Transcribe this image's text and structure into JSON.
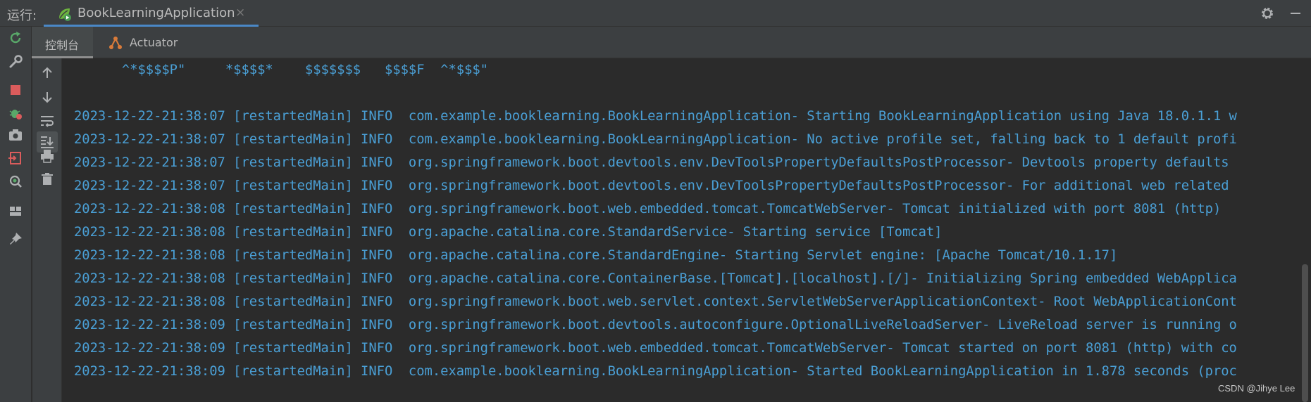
{
  "topbar": {
    "run_label": "运行:",
    "tab_title": "BookLearningApplication",
    "tab_close": "×"
  },
  "subtabs": {
    "console": "控制台",
    "actuator": "Actuator"
  },
  "console": {
    "lines": [
      "      ^*$$$$P\"     *$$$$*    $$$$$$$   $$$$F  ^*$$$\"",
      "",
      "2023-12-22-21:38:07 [restartedMain] INFO  com.example.booklearning.BookLearningApplication- Starting BookLearningApplication using Java 18.0.1.1 w",
      "2023-12-22-21:38:07 [restartedMain] INFO  com.example.booklearning.BookLearningApplication- No active profile set, falling back to 1 default profi",
      "2023-12-22-21:38:07 [restartedMain] INFO  org.springframework.boot.devtools.env.DevToolsPropertyDefaultsPostProcessor- Devtools property defaults",
      "2023-12-22-21:38:07 [restartedMain] INFO  org.springframework.boot.devtools.env.DevToolsPropertyDefaultsPostProcessor- For additional web related",
      "2023-12-22-21:38:08 [restartedMain] INFO  org.springframework.boot.web.embedded.tomcat.TomcatWebServer- Tomcat initialized with port 8081 (http)",
      "2023-12-22-21:38:08 [restartedMain] INFO  org.apache.catalina.core.StandardService- Starting service [Tomcat]",
      "2023-12-22-21:38:08 [restartedMain] INFO  org.apache.catalina.core.StandardEngine- Starting Servlet engine: [Apache Tomcat/10.1.17]",
      "2023-12-22-21:38:08 [restartedMain] INFO  org.apache.catalina.core.ContainerBase.[Tomcat].[localhost].[/]- Initializing Spring embedded WebApplica",
      "2023-12-22-21:38:08 [restartedMain] INFO  org.springframework.boot.web.servlet.context.ServletWebServerApplicationContext- Root WebApplicationCont",
      "2023-12-22-21:38:09 [restartedMain] INFO  org.springframework.boot.devtools.autoconfigure.OptionalLiveReloadServer- LiveReload server is running o",
      "2023-12-22-21:38:09 [restartedMain] INFO  org.springframework.boot.web.embedded.tomcat.TomcatWebServer- Tomcat started on port 8081 (http) with co",
      "2023-12-22-21:38:09 [restartedMain] INFO  com.example.booklearning.BookLearningApplication- Started BookLearningApplication in 1.878 seconds (proc"
    ]
  },
  "watermark": "CSDN @Jihye Lee",
  "colors": {
    "log_text": "#4a9fd5",
    "panel_bg": "#3c3f41",
    "console_bg": "#2b2b2b",
    "tab_underline": "#4a88c7"
  }
}
